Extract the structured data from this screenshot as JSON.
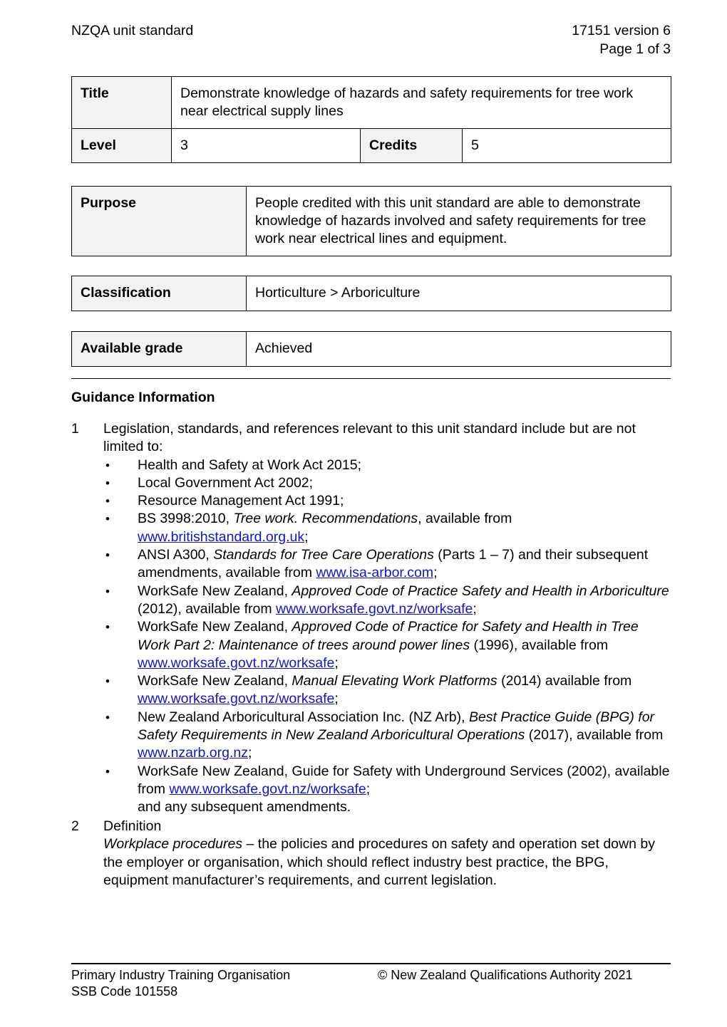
{
  "header": {
    "left": "NZQA unit standard",
    "right_line1": "17151 version 6",
    "right_line2": "Page 1 of 3"
  },
  "tables": {
    "main": {
      "title_label": "Title",
      "title_value": "Demonstrate knowledge of hazards and safety requirements for tree work near electrical supply lines",
      "level_label": "Level",
      "level_value": "3",
      "credits_label": "Credits",
      "credits_value": "5"
    },
    "purpose": {
      "label": "Purpose",
      "value": "People credited with this unit standard are able to demonstrate knowledge of hazards involved and safety requirements for tree work near electrical lines and equipment."
    },
    "classification": {
      "label": "Classification",
      "value": "Horticulture > Arboriculture"
    },
    "available_grade": {
      "label": "Available grade",
      "value": "Achieved"
    }
  },
  "guidance": {
    "heading": "Guidance Information",
    "item1": {
      "number": "1",
      "intro": "Legislation, standards, and references relevant to this unit standard include but are not limited to:",
      "bullet_marker": "•",
      "bullets": [
        {
          "pre": "Health and Safety at Work Act 2015;",
          "italic": "",
          "mid": "",
          "link": "",
          "post": ""
        },
        {
          "pre": "Local Government Act 2002;",
          "italic": "",
          "mid": "",
          "link": "",
          "post": ""
        },
        {
          "pre": "Resource Management Act 1991;",
          "italic": "",
          "mid": "",
          "link": "",
          "post": ""
        },
        {
          "pre": "BS 3998:2010, ",
          "italic": "Tree work. Recommendations",
          "mid": ", available from ",
          "link": "www.britishstandard.org.uk",
          "post": ";"
        },
        {
          "pre": "ANSI A300, ",
          "italic": "Standards for Tree Care Operations",
          "mid": " (Parts 1 – 7) and their subsequent amendments, available from ",
          "link": "www.isa-arbor.com",
          "post": ";"
        },
        {
          "pre": "WorkSafe New Zealand, ",
          "italic": "Approved Code of Practice Safety and Health in Arboriculture",
          "mid": " (2012), available from ",
          "link": "www.worksafe.govt.nz/worksafe",
          "post": ";"
        },
        {
          "pre": "WorkSafe New Zealand, ",
          "italic": "Approved Code of Practice for Safety and Health in Tree Work Part 2: Maintenance of trees around power lines",
          "mid": " (1996), available from ",
          "link": "www.worksafe.govt.nz/worksafe",
          "post": ";"
        },
        {
          "pre": "WorkSafe New Zealand, ",
          "italic": "Manual Elevating Work Platforms",
          "mid": " (2014) available from ",
          "link": "www.worksafe.govt.nz/worksafe",
          "post": ";"
        },
        {
          "pre": "New Zealand Arboricultural Association Inc. (NZ Arb), ",
          "italic": "Best Practice Guide (BPG) for Safety Requirements in New Zealand Arboricultural Operations",
          "mid": " (2017), available from ",
          "link": "www.nzarb.org.nz",
          "post": ";"
        },
        {
          "pre": "WorkSafe New Zealand, Guide for Safety with Underground Services (2002), available from ",
          "italic": "",
          "mid": "",
          "link": "www.worksafe.govt.nz/worksafe",
          "post": ";"
        }
      ],
      "tail": "and any subsequent amendments."
    },
    "item2": {
      "number": "2",
      "heading": "Definition",
      "term": "Workplace procedures",
      "definition": " – the policies and procedures on safety and operation set down by the employer or organisation, which should reflect industry best practice, the BPG, equipment manufacturer’s requirements, and current legislation."
    }
  },
  "footer": {
    "left_line1": "Primary Industry Training Organisation",
    "left_line2": "SSB Code 101558",
    "right": "© New Zealand Qualifications Authority 2021"
  },
  "colors": {
    "link": "#1414cc",
    "label_cell_background": "#f2f2f2",
    "text": "#000000",
    "border": "#000000"
  }
}
